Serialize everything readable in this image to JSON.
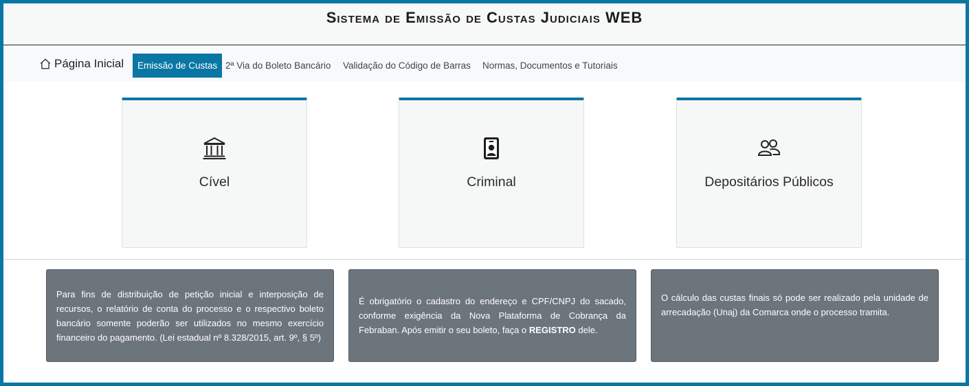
{
  "header": {
    "title": "Sistema de Emissão de Custas Judiciais WEB"
  },
  "nav": {
    "home_icon": "house-icon",
    "home_label": "Página Inicial",
    "items": [
      {
        "label": "Emissão de Custas",
        "active": true
      },
      {
        "label": "2ª Via do Boleto Bancário",
        "active": false
      },
      {
        "label": "Validação do Código de Barras",
        "active": false
      },
      {
        "label": "Normas, Documentos e Tutoriais",
        "active": false
      }
    ]
  },
  "cards": [
    {
      "label": "Cível",
      "icon": "bank-icon"
    },
    {
      "label": "Criminal",
      "icon": "person-badge-icon"
    },
    {
      "label": "Depositários Públicos",
      "icon": "people-icon"
    }
  ],
  "notes": [
    {
      "text": "Para fins de distribuição de petição inicial e interposição de recursos, o relatório de conta do processo e o respectivo boleto bancário somente poderão ser utilizados no mesmo exercício financeiro do pagamento. (Lei estadual nº 8.328/2015, art. 9º, § 5º)"
    },
    {
      "text_before": "É obrigatório o cadastro do endereço e CPF/CNPJ do sacado, conforme exigência da Nova Plataforma de Cobrança da Febraban. Após emitir o seu boleto, faça o ",
      "bold": "REGISTRO",
      "text_after": " dele."
    },
    {
      "text": "O cálculo das custas finais só pode ser realizado pela unidade de arrecadação (Unaj) da Comarca onde o processo tramita."
    }
  ],
  "colors": {
    "accent": "#0a76a4",
    "note_background": "#6c747c",
    "card_background": "#f6f7f7"
  }
}
